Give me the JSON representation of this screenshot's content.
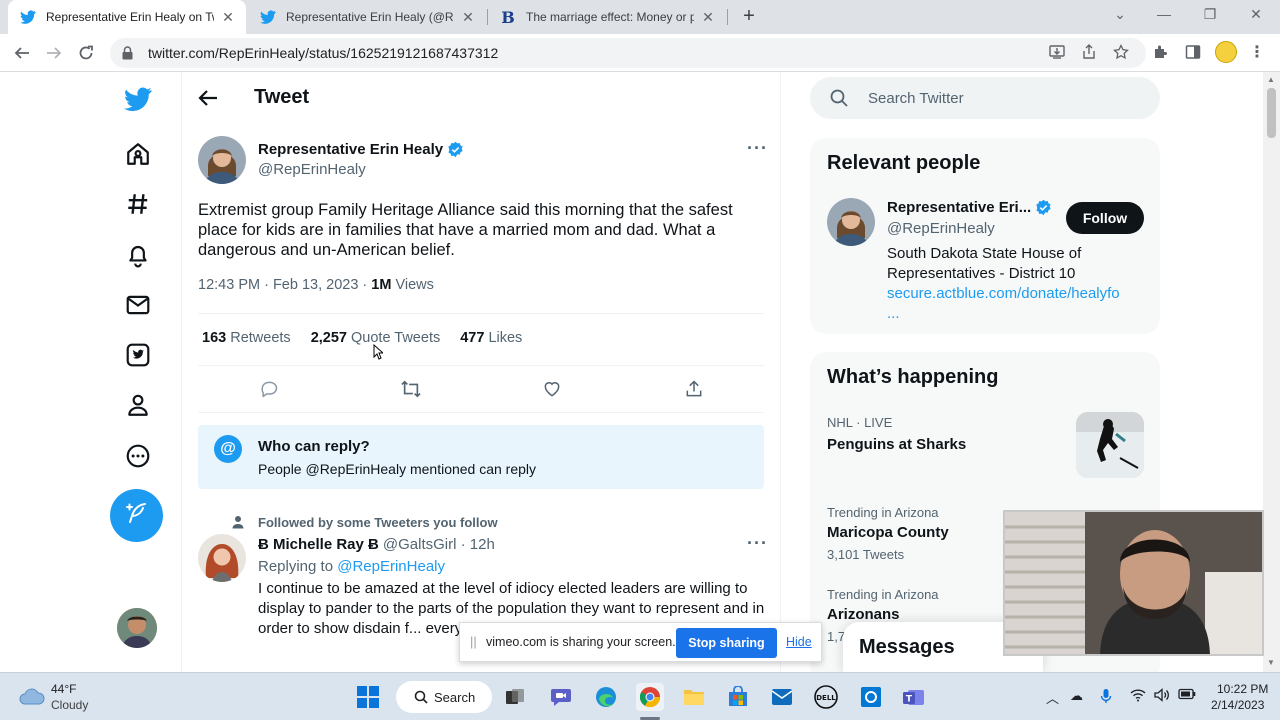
{
  "browser": {
    "tabs": [
      {
        "title": "Representative Erin Healy on Twi",
        "icon": "twitter-bird-icon",
        "active": true
      },
      {
        "title": "Representative Erin Healy (@Rep",
        "icon": "twitter-bird-icon",
        "active": false
      },
      {
        "title": "The marriage effect: Money or pa",
        "icon": "bold-b-icon",
        "active": false
      }
    ],
    "url": "twitter.com/RepErinHealy/status/1625219121687437312"
  },
  "page": {
    "title": "Tweet",
    "tweet": {
      "name": "Representative Erin Healy",
      "handle": "@RepErinHealy",
      "text": "Extremist group Family Heritage Alliance said this morning that the safest place for kids are in families that have a married mom and dad. What a dangerous and un-American belief.",
      "meta_prefix": "12:43 PM · Feb 13, 2023 · ",
      "views_count": "1M",
      "views_label": "Views",
      "retweets_count": "163",
      "retweets_label": "Retweets",
      "quotes_count": "2,257",
      "quotes_label": "Quote Tweets",
      "likes_count": "477",
      "likes_label": "Likes"
    },
    "who_can_reply": {
      "title": "Who can reply?",
      "text": "People @RepErinHealy mentioned can reply"
    },
    "reply": {
      "followed_note": "Followed by some Tweeters you follow",
      "name": "Ƀ Michelle Ray Ƀ",
      "handle_time": "@GaltsGirl · 12h",
      "replying_prefix": "Replying to ",
      "replying_handle": "@RepErinHealy",
      "text": "I continue to be amazed at the level of idiocy elected leaders are willing to display to pander to the parts of the population they want to represent and in order to show disdain f... everyone in their districts."
    }
  },
  "sidebar": {
    "search_placeholder": "Search Twitter",
    "relevant_title": "Relevant people",
    "person": {
      "name": "Representative Eri...",
      "handle": "@RepErinHealy",
      "follow_label": "Follow",
      "bio": "South Dakota State House of Representatives - District 10",
      "link": "secure.actblue.com/donate/healyfo",
      "link_more": "..."
    },
    "happening_title": "What’s happening",
    "trends": [
      {
        "meta": "NHL · LIVE",
        "name": "Penguins at Sharks",
        "count": ""
      },
      {
        "meta": "Trending in Arizona",
        "name": "Maricopa County",
        "count": "3,101 Tweets"
      },
      {
        "meta": "Trending in Arizona",
        "name": "Arizonans",
        "count": "1,7"
      }
    ],
    "messages_label": "Messages"
  },
  "share_bar": {
    "message": "vimeo.com is sharing your screen.",
    "stop_label": "Stop sharing",
    "hide_label": "Hide"
  },
  "taskbar": {
    "temp": "44°F",
    "condition": "Cloudy",
    "search_label": "Search",
    "time": "10:22 PM",
    "date": "2/14/2023"
  },
  "colors": {
    "twitter_blue": "#1d9bf0",
    "text_primary": "#0f1419",
    "text_secondary": "#536471"
  }
}
